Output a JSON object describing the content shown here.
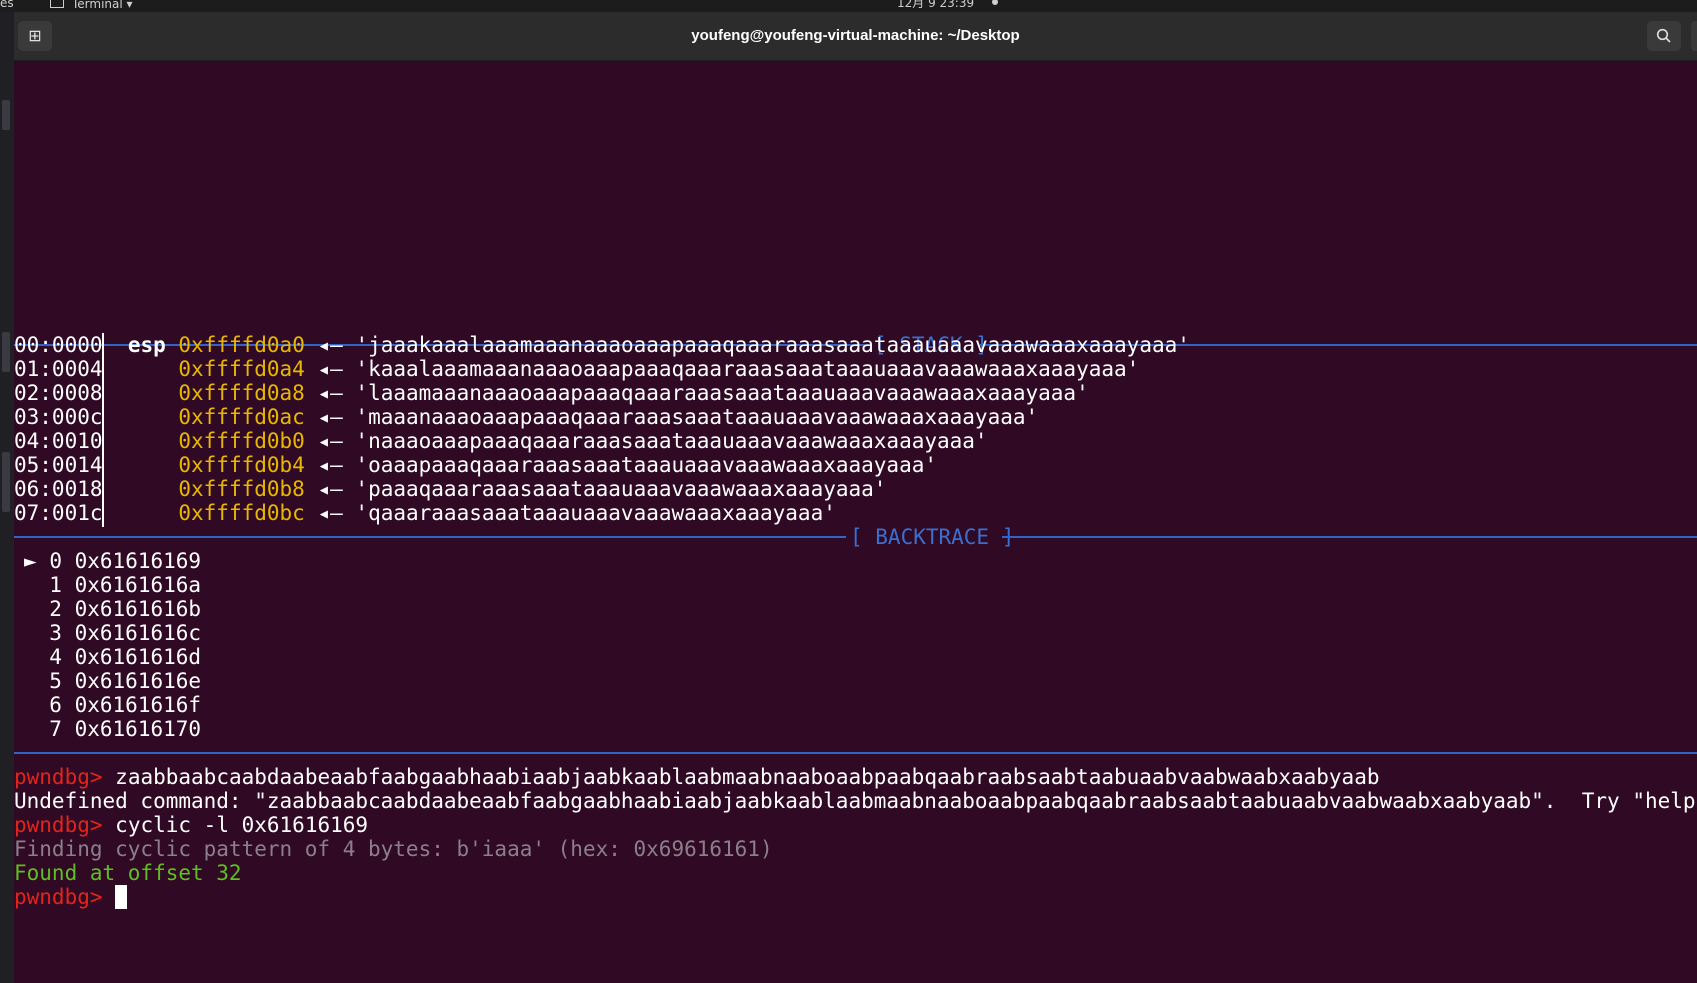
{
  "system_bar": {
    "left_text": "es",
    "app_label": "Terminal",
    "clock": "12月 9 23:39"
  },
  "window": {
    "title": "youfeng@youfeng-virtual-machine: ~/Desktop"
  },
  "stack": {
    "header": "[ STACK ]",
    "rows": [
      {
        "offset": "00:0000",
        "reg": "esp",
        "address": "0xffffd0a0",
        "arrow": "◂—",
        "value": "'jaaakaaalaaamaaanaaaoaaapaaaqaaaraaasaaataaauaaavaaawaaaxaaayaaa'"
      },
      {
        "offset": "01:0004",
        "reg": "",
        "address": "0xffffd0a4",
        "arrow": "◂—",
        "value": "'kaaalaaamaaanaaaoaaapaaaqaaaraaasaaataaauaaavaaawaaaxaaayaaa'"
      },
      {
        "offset": "02:0008",
        "reg": "",
        "address": "0xffffd0a8",
        "arrow": "◂—",
        "value": "'laaamaaanaaaoaaapaaaqaaaraaasaaataaauaaavaaawaaaxaaayaaa'"
      },
      {
        "offset": "03:000c",
        "reg": "",
        "address": "0xffffd0ac",
        "arrow": "◂—",
        "value": "'maaanaaaoaaapaaaqaaaraaasaaataaauaaavaaawaaaxaaayaaa'"
      },
      {
        "offset": "04:0010",
        "reg": "",
        "address": "0xffffd0b0",
        "arrow": "◂—",
        "value": "'naaaoaaapaaaqaaaraaasaaataaauaaavaaawaaaxaaayaaa'"
      },
      {
        "offset": "05:0014",
        "reg": "",
        "address": "0xffffd0b4",
        "arrow": "◂—",
        "value": "'oaaapaaaqaaaraaasaaataaauaaavaaawaaaxaaayaaa'"
      },
      {
        "offset": "06:0018",
        "reg": "",
        "address": "0xffffd0b8",
        "arrow": "◂—",
        "value": "'paaaqaaaraaasaaataaauaaavaaawaaaxaaayaaa'"
      },
      {
        "offset": "07:001c",
        "reg": "",
        "address": "0xffffd0bc",
        "arrow": "◂—",
        "value": "'qaaaraaasaaataaauaaavaaawaaaxaaayaaa'"
      }
    ]
  },
  "backtrace": {
    "header": "[ BACKTRACE ]",
    "marker": "►",
    "frames": [
      {
        "index": "0",
        "address": "0x61616169"
      },
      {
        "index": "1",
        "address": "0x6161616a"
      },
      {
        "index": "2",
        "address": "0x6161616b"
      },
      {
        "index": "3",
        "address": "0x6161616c"
      },
      {
        "index": "4",
        "address": "0x6161616d"
      },
      {
        "index": "5",
        "address": "0x6161616e"
      },
      {
        "index": "6",
        "address": "0x6161616f"
      },
      {
        "index": "7",
        "address": "0x61616170"
      }
    ]
  },
  "console": {
    "prompt": "pwndbg>",
    "command1": "zaabbaabcaabdaabeaabfaabgaabhaabiaabjaabkaablaabmaabnaaboaabpaabqaabraabsaabtaabuaabvaabwaabxaabyaab",
    "error": "Undefined command: \"zaabbaabcaabdaabeaabfaabgaabhaabiaabjaabkaablaabmaabnaaboaabpaabqaabraabsaabtaabuaabvaabwaabxaabyaab\".  Try \"help\".",
    "command2": "cyclic -l 0x61616169",
    "finding": "Finding cyclic pattern of 4 bytes: b'iaaa' (hex: 0x69616161)",
    "found": "Found at offset 32"
  },
  "colors": {
    "background": "#300a24",
    "address": "#e8b800",
    "prompt": "#e2241b",
    "separator": "#3264c8",
    "found": "#5fbf22"
  }
}
